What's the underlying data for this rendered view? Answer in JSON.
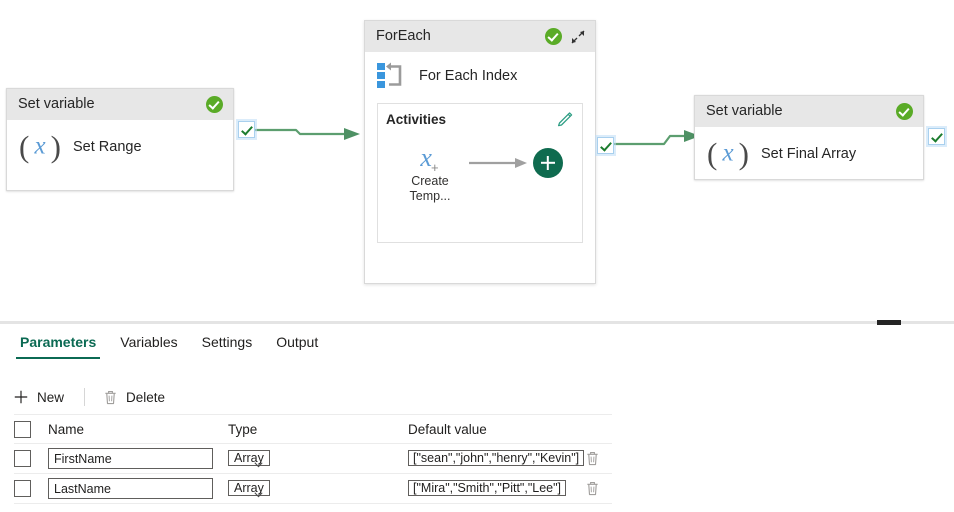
{
  "canvas": {
    "nodes": [
      {
        "id": "set-range",
        "header": "Set variable",
        "label": "Set Range",
        "icon": "variable-x-icon",
        "status": "success-check-icon"
      },
      {
        "id": "foreach",
        "header": "ForEach",
        "label": "For Each Index",
        "icon": "foreach-loop-icon",
        "status": "success-check-icon",
        "collapse_icon": "shrink-diagonal-icon",
        "activities": {
          "title": "Activities",
          "edit_icon": "pencil-icon",
          "items": [
            {
              "label_line1": "Create",
              "label_line2": "Temp...",
              "icon": "variable-x-plus-icon"
            }
          ],
          "add_button": "add-activity-button"
        }
      },
      {
        "id": "set-final-array",
        "header": "Set variable",
        "label": "Set Final Array",
        "icon": "variable-x-icon",
        "status": "success-check-icon"
      }
    ],
    "connectors": [
      {
        "from": "set-range",
        "to": "foreach",
        "port_icon": "green-check-port"
      },
      {
        "from": "foreach",
        "to": "set-final-array",
        "port_icon": "green-check-port"
      },
      {
        "from": "set-final-array",
        "to": "",
        "port_icon": "green-check-port"
      }
    ]
  },
  "bottom": {
    "tabs": [
      {
        "label": "Parameters",
        "active": true
      },
      {
        "label": "Variables",
        "active": false
      },
      {
        "label": "Settings",
        "active": false
      },
      {
        "label": "Output",
        "active": false
      }
    ],
    "commands": [
      {
        "label": "New",
        "icon": "plus-icon"
      },
      {
        "label": "Delete",
        "icon": "trash-icon"
      }
    ],
    "table": {
      "columns": [
        "Name",
        "Type",
        "Default value"
      ],
      "rows": [
        {
          "selected": false,
          "name": "FirstName",
          "type": "Array",
          "default_value": "[\"sean\",\"john\",\"henry\",\"Kevin\"]",
          "delete_icon": "trash-icon"
        },
        {
          "selected": false,
          "name": "LastName",
          "type": "Array",
          "default_value": "[\"Mira\",\"Smith\",\"Pitt\",\"Lee\"]",
          "delete_icon": "trash-icon"
        }
      ]
    }
  },
  "colors": {
    "accent": "#0b6a53",
    "success": "#5aab27",
    "connector": "#5c9e6f",
    "variable_blue": "#5b9bd5",
    "add_button": "#0f6b4f"
  }
}
